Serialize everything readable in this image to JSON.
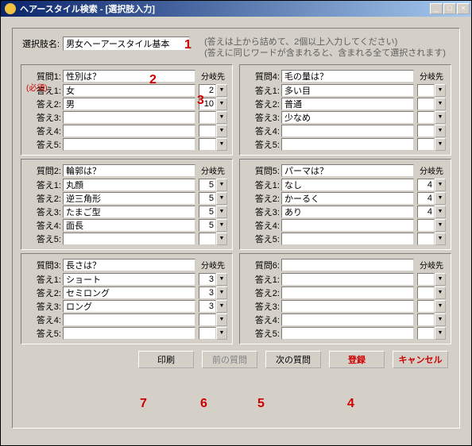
{
  "window": {
    "title": "ヘアースタイル検索 - [選択肢入力]"
  },
  "winbtns": {
    "min": "_",
    "max": "□",
    "close": "×"
  },
  "top": {
    "name_label": "選択肢名:",
    "name_value": "男女ヘーアースタイル基本",
    "hint1": "(答えは上から詰めて、2個以上入力してください)",
    "hint2": "(答えに同じワードが含まれると、含まれる全て選択されます)"
  },
  "labels": {
    "q": [
      "質問1:",
      "質問2:",
      "質問3:",
      "質問4:",
      "質問5:",
      "質問6:"
    ],
    "a": [
      "答え1:",
      "答え2:",
      "答え3:",
      "答え4:",
      "答え5:"
    ],
    "branch": "分岐先",
    "required": "(必須)"
  },
  "groups": [
    {
      "q": "性別は？",
      "a": [
        "女",
        "男",
        "",
        "",
        ""
      ],
      "b": [
        "2",
        "10",
        "",
        "",
        ""
      ]
    },
    {
      "q": "輪郭は？",
      "a": [
        "丸顔",
        "逆三角形",
        "たまご型",
        "面長",
        ""
      ],
      "b": [
        "5",
        "5",
        "5",
        "5",
        ""
      ]
    },
    {
      "q": "長さは？",
      "a": [
        "ショート",
        "セミロング",
        "ロング",
        "",
        ""
      ],
      "b": [
        "3",
        "3",
        "3",
        "",
        ""
      ]
    },
    {
      "q": "毛の量は？",
      "a": [
        "多い目",
        "普通",
        "少なめ",
        "",
        ""
      ],
      "b": [
        "",
        "",
        "",
        "",
        ""
      ]
    },
    {
      "q": "パーマは？",
      "a": [
        "なし",
        "かーるく",
        "あり",
        "",
        ""
      ],
      "b": [
        "4",
        "4",
        "4",
        "",
        ""
      ]
    },
    {
      "q": "",
      "a": [
        "",
        "",
        "",
        "",
        ""
      ],
      "b": [
        "",
        "",
        "",
        "",
        ""
      ]
    }
  ],
  "buttons": {
    "print": "印刷",
    "prev": "前の質問",
    "next": "次の質問",
    "register": "登録",
    "cancel": "キャンセル"
  },
  "markers": [
    "1",
    "2",
    "3",
    "4",
    "5",
    "6",
    "7"
  ]
}
